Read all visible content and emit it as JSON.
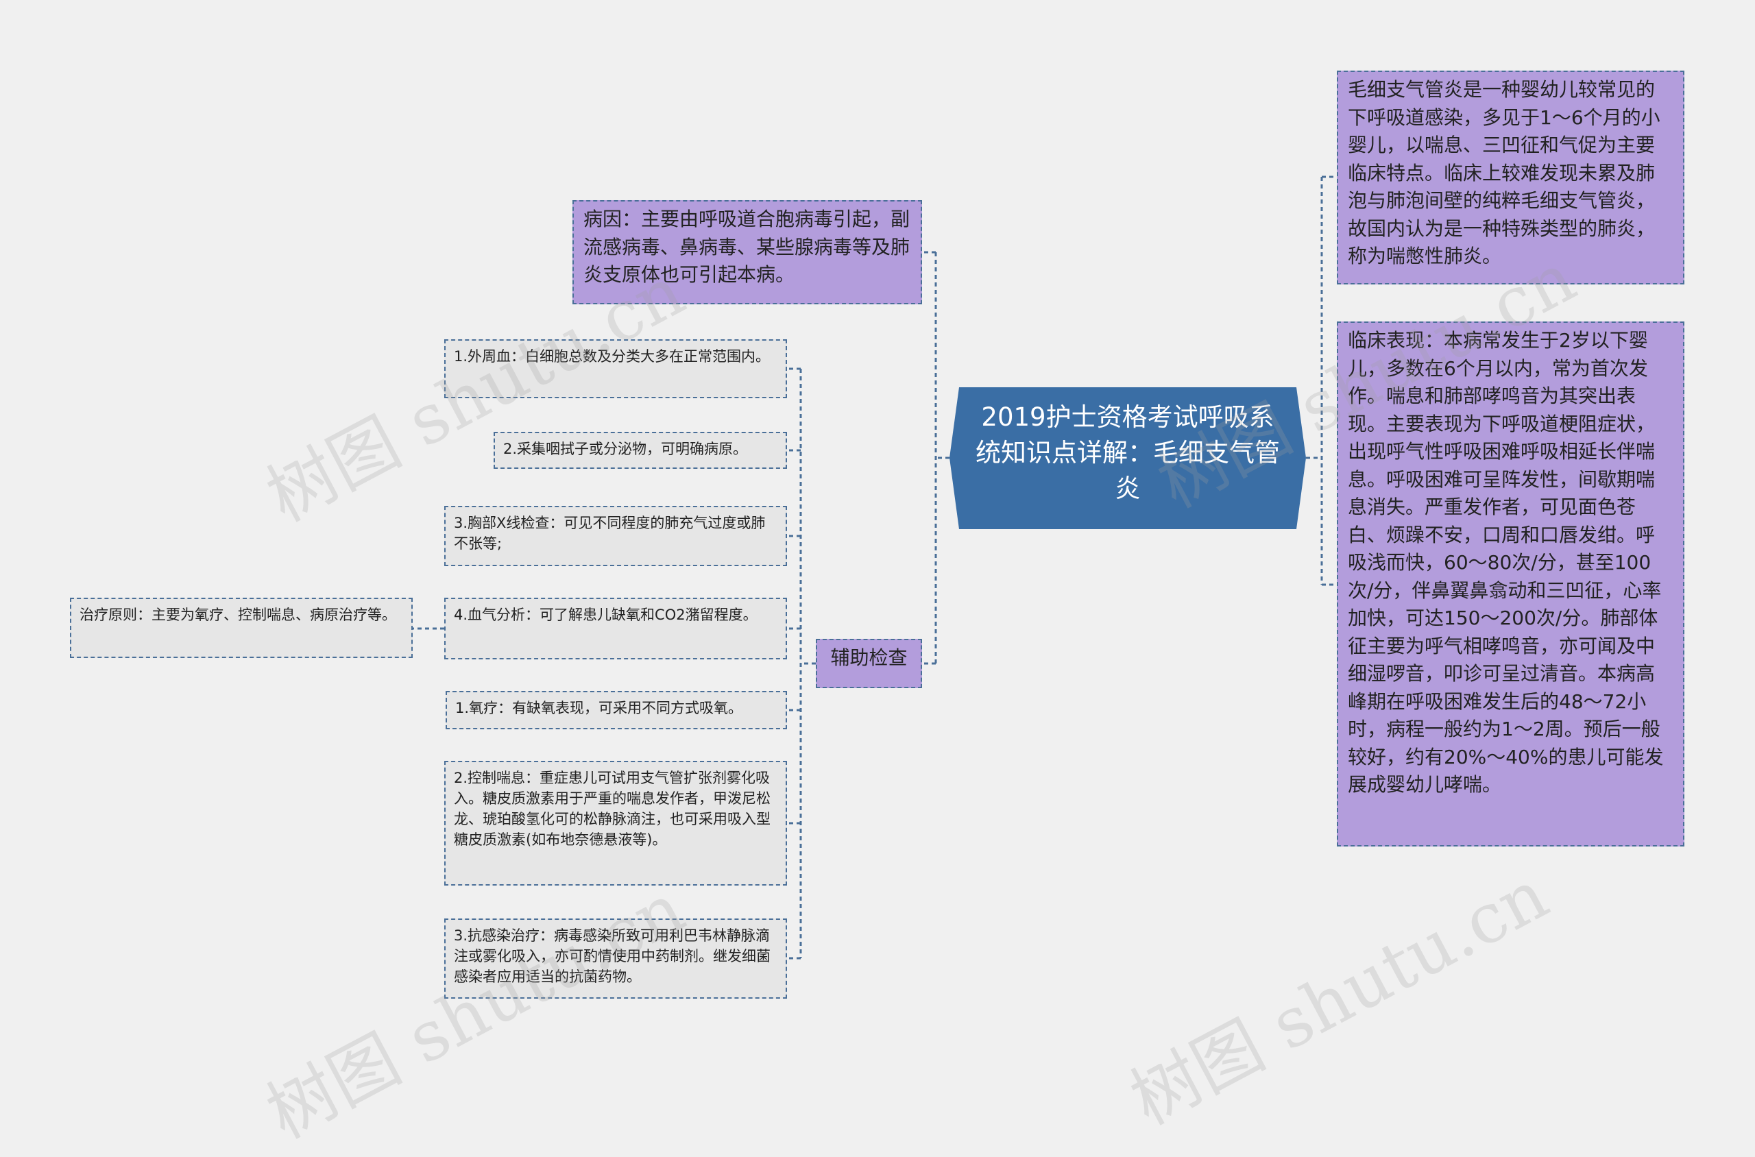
{
  "center": {
    "title": "2019护士资格考试呼吸系统知识点详解：毛细支气管炎"
  },
  "right": [
    {
      "text": "毛细支气管炎是一种婴幼儿较常见的下呼吸道感染，多见于1～6个月的小婴儿，以喘息、三凹征和气促为主要临床特点。临床上较难发现未累及肺泡与肺泡间壁的纯粹毛细支气管炎，故国内认为是一种特殊类型的肺炎，称为喘憋性肺炎。"
    },
    {
      "text": "临床表现：本病常发生于2岁以下婴儿，多数在6个月以内，常为首次发作。喘息和肺部哮鸣音为其突出表现。主要表现为下呼吸道梗阻症状，出现呼气性呼吸困难呼吸相延长伴喘息。呼吸困难可呈阵发性，间歇期喘息消失。严重发作者，可见面色苍白、烦躁不安，口周和口唇发绀。呼吸浅而快，60～80次/分，甚至100次/分，伴鼻翼鼻翕动和三凹征，心率加快，可达150～200次/分。肺部体征主要为呼气相哮鸣音，亦可闻及中细湿啰音，叩诊可呈过清音。本病高峰期在呼吸困难发生后的48～72小时，病程一般约为1～2周。预后一般较好，约有20%～40%的患儿可能发展成婴幼儿哮喘。"
    }
  ],
  "cause": {
    "text": "病因：主要由呼吸道合胞病毒引起，副流感病毒、鼻病毒、某些腺病毒等及肺炎支原体也可引起本病。"
  },
  "aux": {
    "label": "辅助检查",
    "items": [
      {
        "text": "1.外周血：白细胞总数及分类大多在正常范围内。"
      },
      {
        "text": "2.采集咽拭子或分泌物，可明确病原。"
      },
      {
        "text": "3.胸部X线检查：可见不同程度的肺充气过度或肺不张等;"
      },
      {
        "text": "4.血气分析：可了解患儿缺氧和CO2潴留程度。"
      },
      {
        "text": "1.氧疗：有缺氧表现，可采用不同方式吸氧。"
      },
      {
        "text": "2.控制喘息：重症患儿可试用支气管扩张剂雾化吸入。糖皮质激素用于严重的喘息发作者，甲泼尼松龙、琥珀酸氢化可的松静脉滴注，也可采用吸入型糖皮质激素(如布地奈德悬液等)。"
      },
      {
        "text": "3.抗感染治疗：病毒感染所致可用利巴韦林静脉滴注或雾化吸入，亦可酌情使用中药制剂。继发细菌感染者应用适当的抗菌药物。"
      }
    ]
  },
  "treatment": {
    "text": "治疗原则：主要为氧疗、控制喘息、病原治疗等。"
  },
  "watermark": "树图 shutu.cn",
  "colors": {
    "center": "#3a6ea5",
    "purple": "#b39ddc",
    "gray": "#e6e6e6",
    "line": "#4a6f98",
    "background": "#f0f0f0"
  }
}
